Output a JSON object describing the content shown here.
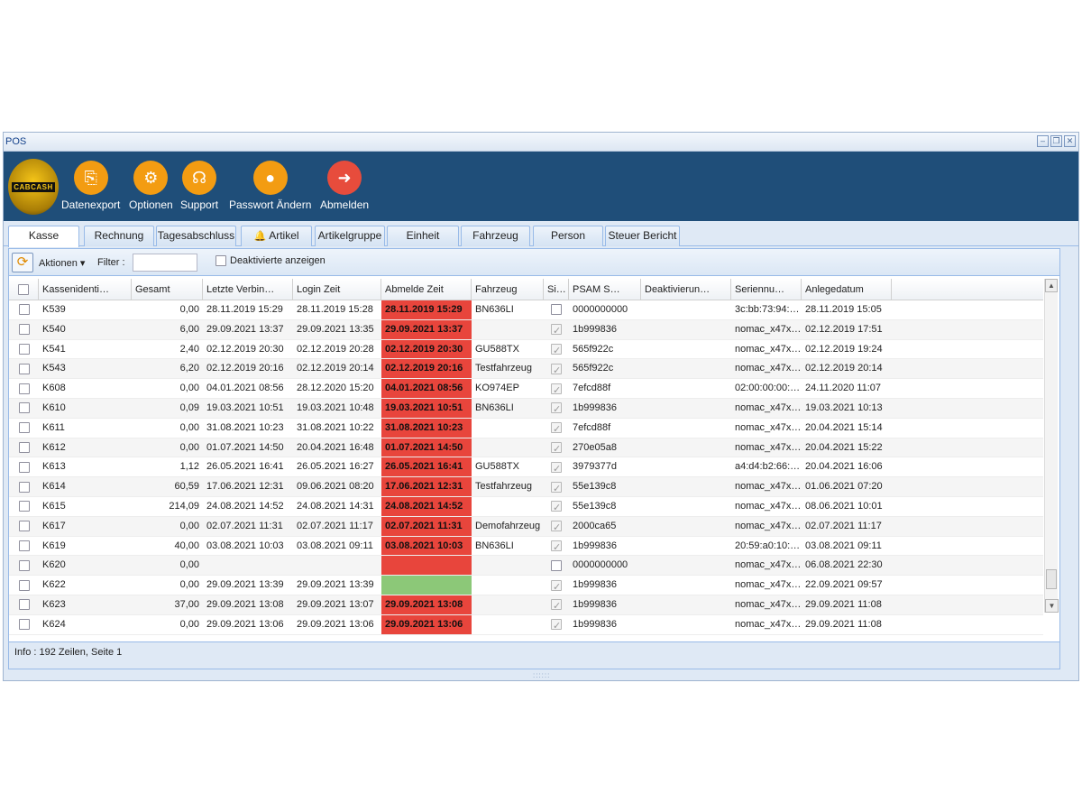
{
  "window": {
    "title": "POS",
    "controls": [
      "–",
      "❐",
      "✕"
    ]
  },
  "toolbar": {
    "logo_text": "CABCASH",
    "items": [
      {
        "label": "Datenexport",
        "icon": "export-icon",
        "glyph": "⎘",
        "color": "#f39c12"
      },
      {
        "label": "Optionen",
        "icon": "gear-icon",
        "glyph": "⚙",
        "color": "#f39c12"
      },
      {
        "label": "Support",
        "icon": "headset-icon",
        "glyph": "☊",
        "color": "#f39c12"
      },
      {
        "label": "Passwort Ändern",
        "icon": "user-icon",
        "glyph": "●",
        "color": "#f39c12"
      },
      {
        "label": "Abmelden",
        "icon": "logout-icon",
        "glyph": "➜",
        "color": "#e74c3c"
      }
    ]
  },
  "tabs": [
    {
      "label": "Kasse",
      "active": true
    },
    {
      "label": "Rechnung",
      "active": false
    },
    {
      "label": "Tagesabschluss",
      "active": false
    },
    {
      "label": "Artikel",
      "active": false,
      "icon": "bell-icon"
    },
    {
      "label": "Artikelgruppe",
      "active": false
    },
    {
      "label": "Einheit",
      "active": false
    },
    {
      "label": "Fahrzeug",
      "active": false
    },
    {
      "label": "Person",
      "active": false
    },
    {
      "label": "Steuer Bericht",
      "active": false
    }
  ],
  "grid_toolbar": {
    "actions_label": "Aktionen",
    "filter_label": "Filter :",
    "filter_value": "",
    "show_deactivated_label": "Deaktivierte anzeigen"
  },
  "columns": [
    "",
    "Kassenidenti…",
    "Gesamt",
    "Letzte Verbin…",
    "Login Zeit",
    "Abmelde Zeit",
    "Fahrzeug",
    "Si…",
    "PSAM S…",
    "Deaktivierun…",
    "Seriennu…",
    "Anlegedatum"
  ],
  "rows": [
    {
      "id": "K539",
      "gesamt": "0,00",
      "letzte": "28.11.2019 15:29",
      "login": "28.11.2019 15:28",
      "abmelde": "28.11.2019 15:29",
      "abmelde_status": "red",
      "fahrzeug": "BN636LI",
      "si": "unchecked",
      "psam": "0000000000",
      "deakt": "",
      "serien": "3c:bb:73:94:…",
      "anlege": "28.11.2019 15:05"
    },
    {
      "id": "K540",
      "gesamt": "6,00",
      "letzte": "29.09.2021 13:37",
      "login": "29.09.2021 13:35",
      "abmelde": "29.09.2021 13:37",
      "abmelde_status": "red",
      "fahrzeug": "",
      "si": "checked",
      "psam": "1b999836",
      "deakt": "",
      "serien": "nomac_x47x…",
      "anlege": "02.12.2019 17:51"
    },
    {
      "id": "K541",
      "gesamt": "2,40",
      "letzte": "02.12.2019 20:30",
      "login": "02.12.2019 20:28",
      "abmelde": "02.12.2019 20:30",
      "abmelde_status": "red",
      "fahrzeug": "GU588TX",
      "si": "checked",
      "psam": "565f922c",
      "deakt": "",
      "serien": "nomac_x47x…",
      "anlege": "02.12.2019 19:24"
    },
    {
      "id": "K543",
      "gesamt": "6,20",
      "letzte": "02.12.2019 20:16",
      "login": "02.12.2019 20:14",
      "abmelde": "02.12.2019 20:16",
      "abmelde_status": "red",
      "fahrzeug": "Testfahrzeug",
      "si": "checked",
      "psam": "565f922c",
      "deakt": "",
      "serien": "nomac_x47x…",
      "anlege": "02.12.2019 20:14"
    },
    {
      "id": "K608",
      "gesamt": "0,00",
      "letzte": "04.01.2021 08:56",
      "login": "28.12.2020 15:20",
      "abmelde": "04.01.2021 08:56",
      "abmelde_status": "red",
      "fahrzeug": "KO974EP",
      "si": "checked",
      "psam": "7efcd88f",
      "deakt": "",
      "serien": "02:00:00:00:…",
      "anlege": "24.11.2020 11:07"
    },
    {
      "id": "K610",
      "gesamt": "0,09",
      "letzte": "19.03.2021 10:51",
      "login": "19.03.2021 10:48",
      "abmelde": "19.03.2021 10:51",
      "abmelde_status": "red",
      "fahrzeug": "BN636LI",
      "si": "checked",
      "psam": "1b999836",
      "deakt": "",
      "serien": "nomac_x47x…",
      "anlege": "19.03.2021 10:13"
    },
    {
      "id": "K611",
      "gesamt": "0,00",
      "letzte": "31.08.2021 10:23",
      "login": "31.08.2021 10:22",
      "abmelde": "31.08.2021 10:23",
      "abmelde_status": "red",
      "fahrzeug": "",
      "si": "checked",
      "psam": "7efcd88f",
      "deakt": "",
      "serien": "nomac_x47x…",
      "anlege": "20.04.2021 15:14"
    },
    {
      "id": "K612",
      "gesamt": "0,00",
      "letzte": "01.07.2021 14:50",
      "login": "20.04.2021 16:48",
      "abmelde": "01.07.2021 14:50",
      "abmelde_status": "red",
      "fahrzeug": "",
      "si": "checked",
      "psam": "270e05a8",
      "deakt": "",
      "serien": "nomac_x47x…",
      "anlege": "20.04.2021 15:22"
    },
    {
      "id": "K613",
      "gesamt": "1,12",
      "letzte": "26.05.2021 16:41",
      "login": "26.05.2021 16:27",
      "abmelde": "26.05.2021 16:41",
      "abmelde_status": "red",
      "fahrzeug": "GU588TX",
      "si": "checked",
      "psam": "3979377d",
      "deakt": "",
      "serien": "a4:d4:b2:66:…",
      "anlege": "20.04.2021 16:06"
    },
    {
      "id": "K614",
      "gesamt": "60,59",
      "letzte": "17.06.2021 12:31",
      "login": "09.06.2021 08:20",
      "abmelde": "17.06.2021 12:31",
      "abmelde_status": "red",
      "fahrzeug": "Testfahrzeug",
      "si": "checked",
      "psam": "55e139c8",
      "deakt": "",
      "serien": "nomac_x47x…",
      "anlege": "01.06.2021 07:20"
    },
    {
      "id": "K615",
      "gesamt": "214,09",
      "letzte": "24.08.2021 14:52",
      "login": "24.08.2021 14:31",
      "abmelde": "24.08.2021 14:52",
      "abmelde_status": "red",
      "fahrzeug": "",
      "si": "checked",
      "psam": "55e139c8",
      "deakt": "",
      "serien": "nomac_x47x…",
      "anlege": "08.06.2021 10:01"
    },
    {
      "id": "K617",
      "gesamt": "0,00",
      "letzte": "02.07.2021 11:31",
      "login": "02.07.2021 11:17",
      "abmelde": "02.07.2021 11:31",
      "abmelde_status": "red",
      "fahrzeug": "Demofahrzeug",
      "si": "checked",
      "psam": "2000ca65",
      "deakt": "",
      "serien": "nomac_x47x…",
      "anlege": "02.07.2021 11:17"
    },
    {
      "id": "K619",
      "gesamt": "40,00",
      "letzte": "03.08.2021 10:03",
      "login": "03.08.2021 09:11",
      "abmelde": "03.08.2021 10:03",
      "abmelde_status": "red",
      "fahrzeug": "BN636LI",
      "si": "checked",
      "psam": "1b999836",
      "deakt": "",
      "serien": "20:59:a0:10:…",
      "anlege": "03.08.2021 09:11"
    },
    {
      "id": "K620",
      "gesamt": "0,00",
      "letzte": "",
      "login": "",
      "abmelde": "",
      "abmelde_status": "red",
      "fahrzeug": "",
      "si": "unchecked",
      "psam": "0000000000",
      "deakt": "",
      "serien": "nomac_x47x…",
      "anlege": "06.08.2021 22:30"
    },
    {
      "id": "K622",
      "gesamt": "0,00",
      "letzte": "29.09.2021 13:39",
      "login": "29.09.2021 13:39",
      "abmelde": "",
      "abmelde_status": "green",
      "fahrzeug": "",
      "si": "checked",
      "psam": "1b999836",
      "deakt": "",
      "serien": "nomac_x47x…",
      "anlege": "22.09.2021 09:57"
    },
    {
      "id": "K623",
      "gesamt": "37,00",
      "letzte": "29.09.2021 13:08",
      "login": "29.09.2021 13:07",
      "abmelde": "29.09.2021 13:08",
      "abmelde_status": "red",
      "fahrzeug": "",
      "si": "checked",
      "psam": "1b999836",
      "deakt": "",
      "serien": "nomac_x47x…",
      "anlege": "29.09.2021 11:08"
    },
    {
      "id": "K624",
      "gesamt": "0,00",
      "letzte": "29.09.2021 13:06",
      "login": "29.09.2021 13:06",
      "abmelde": "29.09.2021 13:06",
      "abmelde_status": "red",
      "fahrzeug": "",
      "si": "checked",
      "psam": "1b999836",
      "deakt": "",
      "serien": "nomac_x47x…",
      "anlege": "29.09.2021 11:08"
    }
  ],
  "status_colors": {
    "red": "#e8453c",
    "green": "#8cc878",
    "header_blue": "#1f4e79"
  },
  "info": {
    "text": "Info :  192 Zeilen, Seite 1"
  }
}
